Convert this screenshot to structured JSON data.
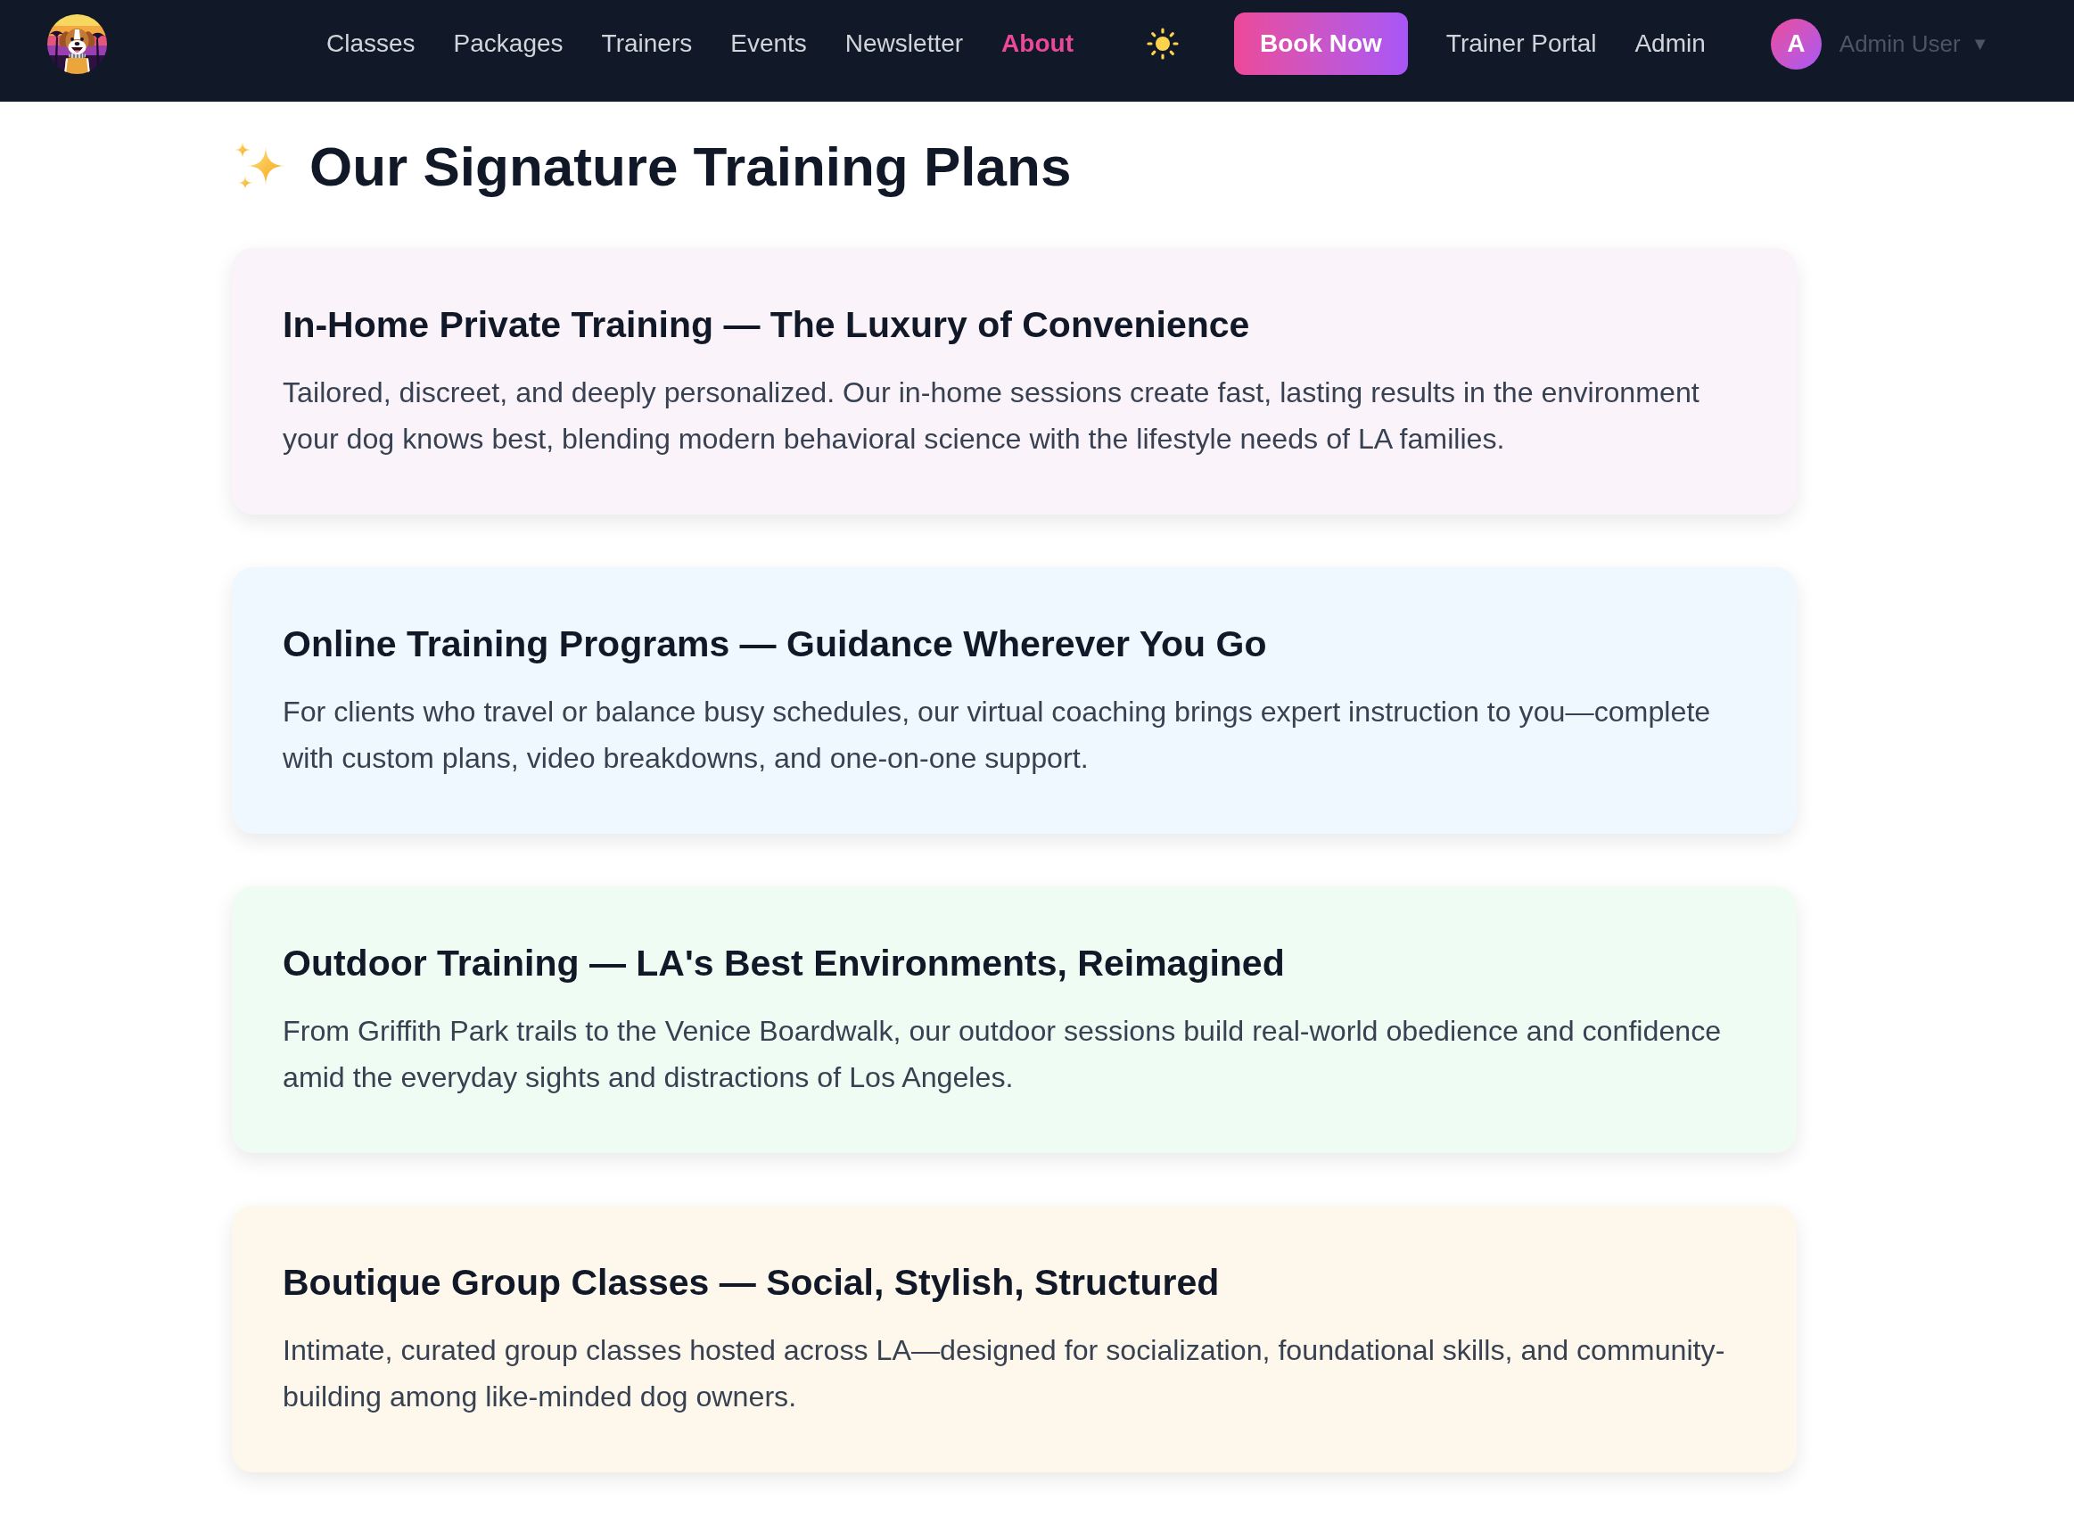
{
  "nav": {
    "links": [
      {
        "label": "Classes",
        "selected": false
      },
      {
        "label": "Packages",
        "selected": false
      },
      {
        "label": "Trainers",
        "selected": false
      },
      {
        "label": "Events",
        "selected": false
      },
      {
        "label": "Newsletter",
        "selected": false
      },
      {
        "label": "About",
        "selected": true
      }
    ],
    "book_button": "Book Now",
    "more_links": [
      {
        "label": "Trainer Portal",
        "selected": false
      },
      {
        "label": "Admin",
        "selected": false
      }
    ],
    "user": {
      "avatar_initial": "A",
      "name": "Admin User",
      "caret": "▼"
    }
  },
  "page_title": "Our Signature Training Plans",
  "plans": [
    {
      "title": "In-Home Private Training — The Luxury of Convenience",
      "body": "Tailored, discreet, and deeply personalized. Our in-home sessions create fast, lasting results in the environment your dog knows best, blending modern behavioral science with the lifestyle needs of LA families.",
      "color": "#faf3f9"
    },
    {
      "title": "Online Training Programs — Guidance Wherever You Go",
      "body": "For clients who travel or balance busy schedules, our virtual coaching brings expert instruction to you—complete with custom plans, video breakdowns, and one-on-one support.",
      "color": "#eff8fe"
    },
    {
      "title": "Outdoor Training — LA's Best Environments, Reimagined",
      "body": "From Griffith Park trails to the Venice Boardwalk, our outdoor sessions build real-world obedience and confidence amid the everyday sights and distractions of Los Angeles.",
      "color": "#effcf4"
    },
    {
      "title": "Boutique Group Classes — Social, Stylish, Structured",
      "body": "Intimate, curated group classes hosted across LA—designed for socialization, foundational skills, and community-building among like-minded dog owners.",
      "color": "#fef8ec"
    }
  ]
}
